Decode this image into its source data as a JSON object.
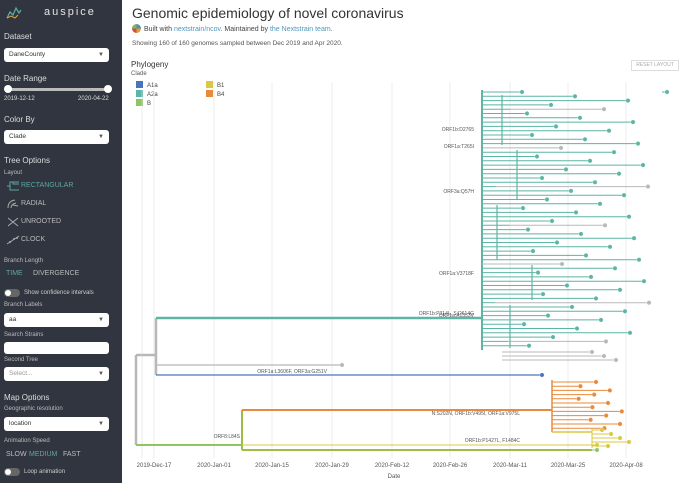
{
  "app": {
    "name": "auspice"
  },
  "sidebar": {
    "dataset_label": "Dataset",
    "dataset_value": "DaneCounty",
    "date_range_label": "Date Range",
    "date_start": "2019-12-12",
    "date_end": "2020-04-22",
    "color_by_label": "Color By",
    "color_by_value": "Clade",
    "tree_options_label": "Tree Options",
    "layout_label": "Layout",
    "layouts": [
      "RECTANGULAR",
      "RADIAL",
      "UNROOTED",
      "CLOCK"
    ],
    "active_layout": "RECTANGULAR",
    "branch_length_label": "Branch Length",
    "branch_length_options": [
      "TIME",
      "DIVERGENCE"
    ],
    "active_branch_length": "TIME",
    "confidence_label": "Show confidence intervals",
    "branch_labels_label": "Branch Labels",
    "branch_labels_value": "aa",
    "search_strains_label": "Search Strains",
    "second_tree_label": "Second Tree",
    "second_tree_placeholder": "Select...",
    "map_options_label": "Map Options",
    "geo_resolution_label": "Geographic resolution",
    "geo_resolution_value": "location",
    "animation_speed_label": "Animation Speed",
    "animation_speeds": [
      "SLOW",
      "MEDIUM",
      "FAST"
    ],
    "active_speed": "MEDIUM",
    "loop_animation_label": "Loop animation"
  },
  "header": {
    "title": "Genomic epidemiology of novel coronavirus",
    "built_with_prefix": "Built with",
    "built_with_link": "nextstrain/ncov",
    "maintained_by_prefix": ". Maintained by",
    "maintained_by_link": "the Nextstrain team",
    "maintained_by_suffix": ".",
    "showing": "Showing 160 of 160 genomes sampled between Dec 2019 and Apr 2020."
  },
  "phylogeny": {
    "title": "Phylogeny",
    "reset_label": "RESET LAYOUT",
    "legend_title": "Clade",
    "legend": [
      {
        "name": "A1a",
        "color": "#4c73bd"
      },
      {
        "name": "A2a",
        "color": "#5cb5a5"
      },
      {
        "name": "B",
        "color": "#8fc464"
      },
      {
        "name": "B1",
        "color": "#d9c840"
      },
      {
        "name": "B4",
        "color": "#e88a3a"
      }
    ],
    "branch_labels": [
      "ORF1b:D2765",
      "ORF1a:T265I",
      "ORF3a:Q57H",
      "ORF1a:V3718F",
      "ORF1a:A1353V",
      "ORF1b:P314L, S:D614G",
      "ORF1a:L3606F, ORF3a:G251V",
      "N:S202N, ORF1b:V495I, ORF1a:V975L",
      "ORF8:L84S",
      "ORF1b:P1427L, F1484C"
    ],
    "x_ticks": [
      "2019-Dec-17",
      "2020-Jan-01",
      "2020-Jan-15",
      "2020-Jan-29",
      "2020-Feb-12",
      "2020-Feb-26",
      "2020-Mar-11",
      "2020-Mar-25",
      "2020-Apr-08"
    ],
    "x_axis_label": "Date"
  }
}
